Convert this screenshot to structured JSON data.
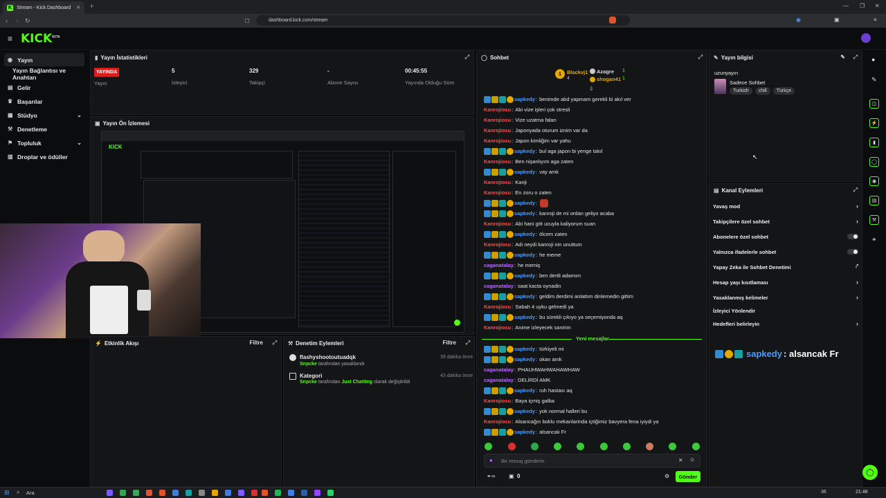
{
  "browser": {
    "tab_title": "Stream - Kick Dashboard",
    "url": "dashboard.kick.com/stream"
  },
  "app": {
    "logo": "KICK",
    "logo_badge": "BETA"
  },
  "sidebar": {
    "items": [
      {
        "label": "Yayın",
        "icon": "broadcast-icon",
        "active": true
      },
      {
        "label": "Yayın Bağlantısı ve Anahtarı",
        "icon": "",
        "active": false
      },
      {
        "label": "Gelir",
        "icon": "wallet-icon"
      },
      {
        "label": "Başarılar",
        "icon": "trophy-icon"
      },
      {
        "label": "Stüdyo",
        "icon": "studio-icon",
        "expandable": true
      },
      {
        "label": "Denetleme",
        "icon": "hammer-icon"
      },
      {
        "label": "Topluluk",
        "icon": "community-icon",
        "expandable": true
      },
      {
        "label": "Droplar ve ödüller",
        "icon": "gift-icon"
      }
    ]
  },
  "stats": {
    "title": "Yayın İstatistikleri",
    "live_badge": "YAYINDA",
    "items": [
      {
        "value": "",
        "label": "Yayın"
      },
      {
        "value": "5",
        "label": "İzleyici"
      },
      {
        "value": "329",
        "label": "Takipçi"
      },
      {
        "value": "-",
        "label": "Abone Sayısı"
      },
      {
        "value": "00:45:55",
        "label": "Yayında Olduğu Süre"
      }
    ]
  },
  "preview": {
    "title": "Yayın Ön İzlemesi"
  },
  "activity": {
    "title": "Etkinlik Akışı",
    "filter": "Filtre"
  },
  "mod_actions": {
    "title": "Denetim Eylemleri",
    "filter": "Filtre",
    "items": [
      {
        "title": "flashyshootoutuadqk",
        "actor": "Snpcke",
        "detail": "tarafından yasaklandı",
        "time": "39 dakika önce"
      },
      {
        "title": "Kategori",
        "actor": "Snpcke",
        "detail": "tarafından",
        "highlight": "Just Chatting",
        "detail2": "olarak değiştirildi",
        "time": "43 dakika önce"
      }
    ]
  },
  "chat": {
    "title": "Sohbet",
    "top_gifters": [
      {
        "name": "Blackvj1",
        "count": "4",
        "rank": "1"
      },
      {
        "name": "Azagre",
        "count": "1"
      },
      {
        "name": "shogan41",
        "count": "1"
      }
    ],
    "messages": [
      {
        "user": "sapkedy",
        "text": "benimde abd yapmam gerekli bi akıl ver",
        "badges": true
      },
      {
        "user": "Kanrojiosu",
        "text": "Abi vize işleri çok stresli"
      },
      {
        "user": "Kanrojiosu",
        "text": "Vize uzatma falan"
      },
      {
        "user": "Kanrojiosu",
        "text": "Japonyada oturum iznim var da"
      },
      {
        "user": "Kanrojiosu",
        "text": "Japon kimliğim var yahu"
      },
      {
        "user": "sapkedy",
        "text": "bul aga japon bi yenge takıl",
        "badges": true
      },
      {
        "user": "Kanrojiosu",
        "text": "Ben nişanlıyım aga zaten"
      },
      {
        "user": "sapkedy",
        "text": "vay amk",
        "badges": true
      },
      {
        "user": "Kanrojiosu",
        "text": "Kanji"
      },
      {
        "user": "Kanrojiosu",
        "text": "En zoru o zaten"
      },
      {
        "user": "sapkedy",
        "text": "",
        "badges": true,
        "emote": true
      },
      {
        "user": "sapkedy",
        "text": "kanroji de mi ordan geliyo acaba",
        "badges": true
      },
      {
        "user": "Kanrojiosu",
        "text": "Abi hani göt ucuyla kaliyorum suan"
      },
      {
        "user": "sapkedy",
        "text": "ölcem zaten",
        "badges": true
      },
      {
        "user": "Kanrojiosu",
        "text": "Adi neydi kanroji nin unuttum"
      },
      {
        "user": "sapkedy",
        "text": "he meme",
        "badges": true
      },
      {
        "user": "caganatalay",
        "text": "he memiş"
      },
      {
        "user": "sapkedy",
        "text": "ben dertli adamım",
        "badges": true
      },
      {
        "user": "caganatalay",
        "text": "saat kacta oynadin"
      },
      {
        "user": "sapkedy",
        "text": "geldim derdimi anlattım dinlemedin gittim",
        "badges": true
      },
      {
        "user": "Kanrojiosu",
        "text": "Sabah 4 uyku gelmedi ya"
      },
      {
        "user": "sapkedy",
        "text": "bu sürekli çıkıyo ya seçemiyonda aq",
        "badges": true
      },
      {
        "user": "Kanrojiosu",
        "text": "Anime izleyecek sanirim"
      }
    ],
    "new_messages_label": "Yeni mesajlar",
    "new_messages": [
      {
        "user": "sapkedy",
        "text": "türkiyeli mi",
        "badges": true
      },
      {
        "user": "sapkedy",
        "text": "okan amk",
        "badges": true
      },
      {
        "user": "caganatalay",
        "text": "PHAUHWAHWAHAWHAW"
      },
      {
        "user": "caganatalay",
        "text": "DELİRDİ AMK"
      },
      {
        "user": "sapkedy",
        "text": "ruh hastası aq",
        "badges": true
      },
      {
        "user": "Kanrojiosu",
        "text": "Baya içmiş galba"
      },
      {
        "user": "sapkedy",
        "text": "yok normal halleri bu",
        "badges": true
      },
      {
        "user": "Kanrojiosu",
        "text": "Alsancağın boklu mekanlarinda içtiğimiz bavyera fena iyiydi ya"
      },
      {
        "user": "sapkedy",
        "text": "alsancak Fr",
        "badges": true
      }
    ],
    "input_placeholder": "Bir mesaj gönderin",
    "points": "0",
    "send_label": "Gönder"
  },
  "stream_info": {
    "title": "Yayın bilgisi",
    "stream_title": "uzunyayın",
    "category": "Sadece Sohbet",
    "tags": [
      "Turkish",
      "chill",
      "Türkçe"
    ]
  },
  "channel_actions": {
    "title": "Kanal Eylemleri",
    "items": [
      {
        "label": "Yavaş mod",
        "type": "chevron"
      },
      {
        "label": "Takipçilere özel sohbet",
        "type": "chevron"
      },
      {
        "label": "Abonelere özel sohbet",
        "type": "toggle"
      },
      {
        "label": "Yalnızca ifadelerle sohbet",
        "type": "toggle"
      },
      {
        "label": "Yapay Zeka ile Sohbet Denetimi",
        "type": "external"
      },
      {
        "label": "Hesap yaşı kısıtlaması",
        "type": "chevron"
      },
      {
        "label": "Yasaklanmış kelimeler",
        "type": "chevron"
      },
      {
        "label": "İzleyici Yönlendir",
        "type": "none"
      },
      {
        "label": "Hedefleri belirleyin",
        "type": "chevron"
      }
    ]
  },
  "overlay": {
    "user": "sapkedy",
    "text": ": alsancak Fr"
  },
  "taskbar": {
    "search": "Ara",
    "time": "21:48",
    "temp": "36"
  },
  "colors": {
    "accent": "#53fc18",
    "live": "#d62020",
    "panel": "#141517"
  }
}
